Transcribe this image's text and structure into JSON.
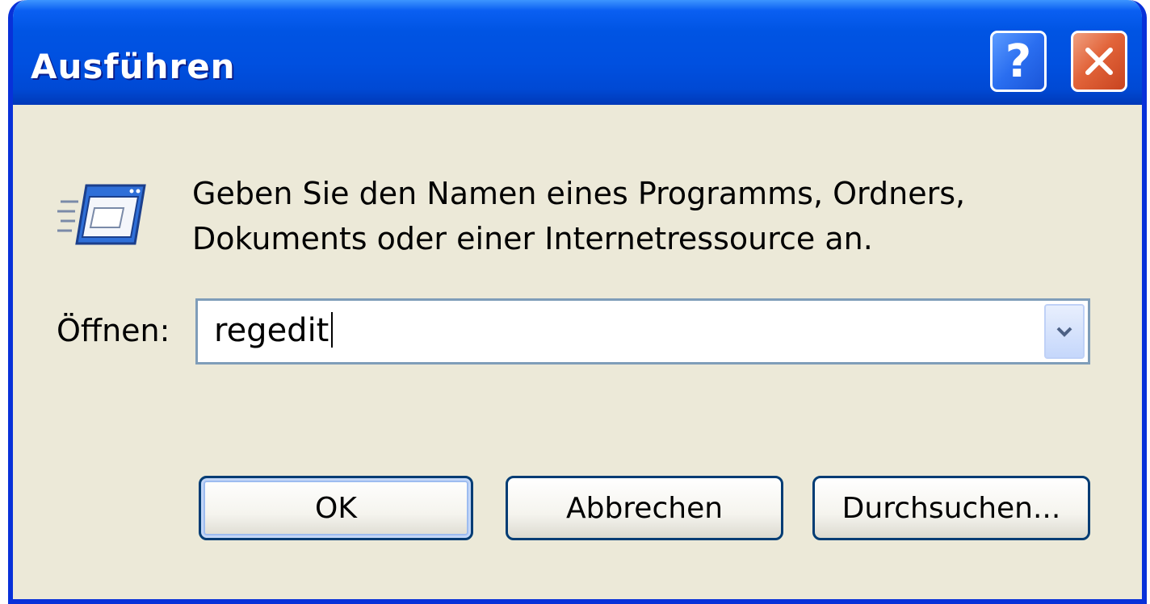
{
  "window": {
    "title": "Ausführen",
    "help_label": "?"
  },
  "dialog": {
    "prompt_line1": "Geben Sie den Namen eines Programms, Ordners,",
    "prompt_line2": "Dokuments oder einer Internetressource an.",
    "open_label": "Öffnen:",
    "open_value": "regedit"
  },
  "buttons": {
    "ok": "OK",
    "cancel": "Abbrechen",
    "browse": "Durchsuchen..."
  },
  "icons": {
    "run": "run-program-icon",
    "help": "help-icon",
    "close": "close-icon",
    "dropdown": "chevron-down-icon"
  },
  "colors": {
    "titlebar": "#0054e3",
    "close_button": "#e2643a",
    "dialog_bg": "#ece9d8",
    "button_border": "#003c74"
  }
}
